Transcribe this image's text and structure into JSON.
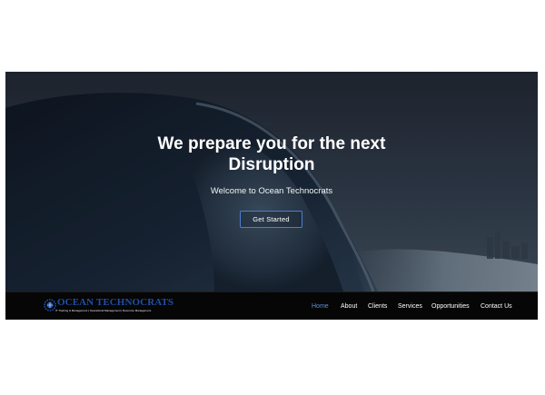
{
  "hero": {
    "headline_line1": "We prepare you for the next",
    "headline_line2": "Disruption",
    "tagline": "Welcome to Ocean Technocrats",
    "cta_label": "Get Started"
  },
  "brand": {
    "name": "OCEAN TECHNOCRATS",
    "subtitle": "IT Training & Management | Operational Management | Resource Management",
    "logo_icon": "gear-globe-icon",
    "color": "#1f4fa8"
  },
  "nav": {
    "items": [
      {
        "label": "Home",
        "active": true
      },
      {
        "label": "About",
        "active": false
      },
      {
        "label": "Clients",
        "active": false
      },
      {
        "label": "Services",
        "active": false
      },
      {
        "label": "Opportunities",
        "active": false
      },
      {
        "label": "Contact Us",
        "active": false
      }
    ],
    "active_color": "#5f8fd8"
  }
}
